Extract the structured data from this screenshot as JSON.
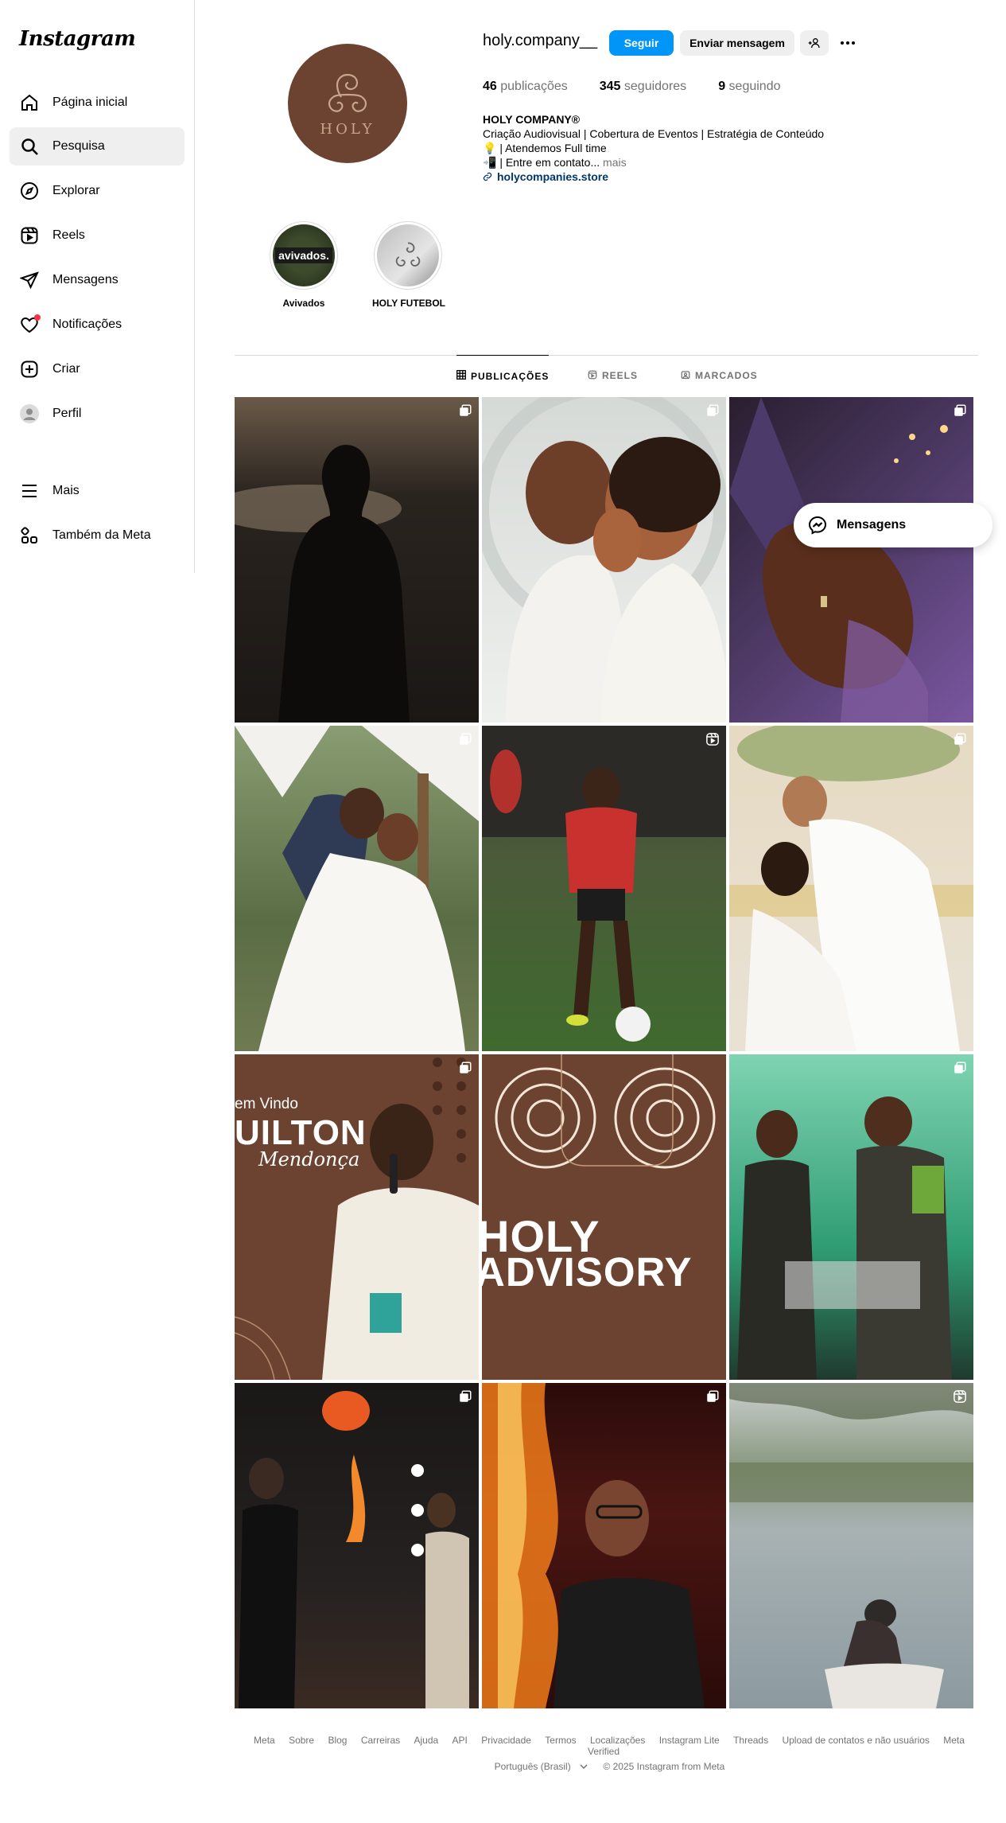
{
  "app": {
    "logo": "Instagram"
  },
  "sidebar": {
    "items": [
      {
        "label": "Página inicial",
        "icon": "home-icon"
      },
      {
        "label": "Pesquisa",
        "icon": "search-icon"
      },
      {
        "label": "Explorar",
        "icon": "compass-icon"
      },
      {
        "label": "Reels",
        "icon": "reels-icon"
      },
      {
        "label": "Mensagens",
        "icon": "send-icon"
      },
      {
        "label": "Notificações",
        "icon": "heart-icon"
      },
      {
        "label": "Criar",
        "icon": "plus-square-icon"
      },
      {
        "label": "Perfil",
        "icon": "avatar-icon"
      },
      {
        "label": "Mais",
        "icon": "menu-icon"
      },
      {
        "label": "Também da Meta",
        "icon": "meta-apps-icon"
      }
    ],
    "active_item": "Pesquisa"
  },
  "profile": {
    "avatar_text": "HOLY",
    "username": "holy.company__",
    "follow_label": "Seguir",
    "message_label": "Enviar mensagem",
    "stats": {
      "posts_count": "46",
      "posts_label": "publicações",
      "followers_count": "345",
      "followers_label": "seguidores",
      "following_count": "9",
      "following_label": "seguindo"
    },
    "bio": {
      "name": "HOLY COMPANY®",
      "line1": "Criação Audiovisual | Cobertura de Eventos | Estratégia de Conteúdo",
      "line2": "💡 | Atendemos Full time",
      "line3": "📲 | Entre em contato...",
      "more": "mais",
      "link": "holycompanies.store"
    }
  },
  "highlights": [
    {
      "label": "Avivados",
      "cover_text": "avivados."
    },
    {
      "label": "HOLY FUTEBOL"
    }
  ],
  "tabs": [
    {
      "label": "PUBLICAÇÕES",
      "icon": "grid-icon"
    },
    {
      "label": "REELS",
      "icon": "reels-icon"
    },
    {
      "label": "MARCADOS",
      "icon": "tagged-icon"
    }
  ],
  "posts": [
    {
      "subject": "bride-silhouette",
      "badge": "carousel-icon"
    },
    {
      "subject": "couple-kiss",
      "badge": "carousel-icon"
    },
    {
      "subject": "hands-ring",
      "badge": "carousel-icon"
    },
    {
      "subject": "wedding-dip-kiss",
      "badge": "carousel-icon"
    },
    {
      "subject": "soccer-player",
      "badge": "reels-icon"
    },
    {
      "subject": "couple-embrace",
      "badge": "carousel-icon"
    },
    {
      "subject": "speaker-promo",
      "badge": "carousel-icon",
      "text_line1": "em Vindo",
      "text_line2": "UILTON",
      "text_line3": "Mendonça"
    },
    {
      "subject": "holy-advisory-graphic",
      "badge": "",
      "text_line1": "HOLY",
      "text_line2": "ADVISORY"
    },
    {
      "subject": "stage-singers",
      "badge": "carousel-icon"
    },
    {
      "subject": "stage-fire",
      "badge": "carousel-icon"
    },
    {
      "subject": "man-glasses-fire",
      "badge": "carousel-icon"
    },
    {
      "subject": "river-fisherman",
      "badge": "reels-icon"
    }
  ],
  "floating_messages": {
    "label": "Mensagens"
  },
  "footer": {
    "links": [
      "Meta",
      "Sobre",
      "Blog",
      "Carreiras",
      "Ajuda",
      "API",
      "Privacidade",
      "Termos",
      "Localizações",
      "Instagram Lite",
      "Threads",
      "Upload de contatos e não usuários",
      "Meta Verified"
    ],
    "language": "Português (Brasil)",
    "copyright": "© 2025 Instagram from Meta"
  },
  "colors": {
    "accent": "#0095f6",
    "brand_brown": "#6b4330",
    "notification": "#ff3040"
  }
}
